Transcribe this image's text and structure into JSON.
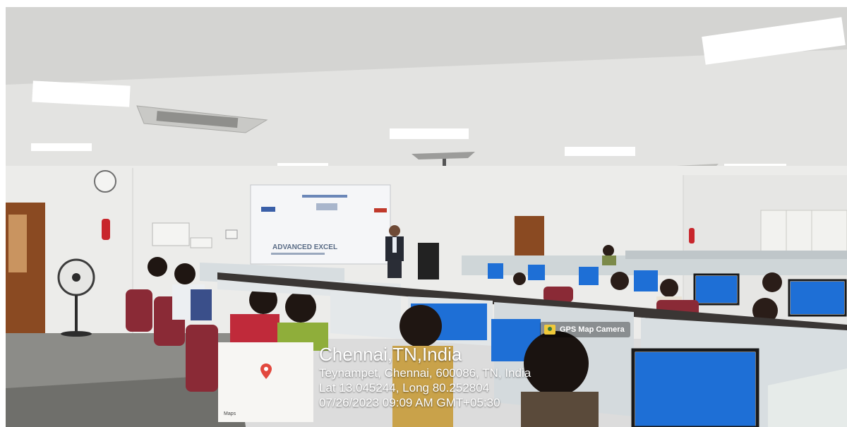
{
  "overlay": {
    "app_label": "GPS Map Camera",
    "city": "Chennai,TN,India",
    "address": "Teynampet, Chennai, 600086, TN, India",
    "coordinates": "Lat 13.045244, Long 80.252804",
    "datetime": "07/26/2023 09:09 AM GMT+05:30",
    "map_credit": "Maps"
  },
  "projection": {
    "heading": "ADVANCED EXCEL"
  },
  "colors": {
    "pin": "#e2483d",
    "monitor_screen": "#1e6fd6",
    "chair": "#8a2a36",
    "partition": "#d7dde0"
  }
}
